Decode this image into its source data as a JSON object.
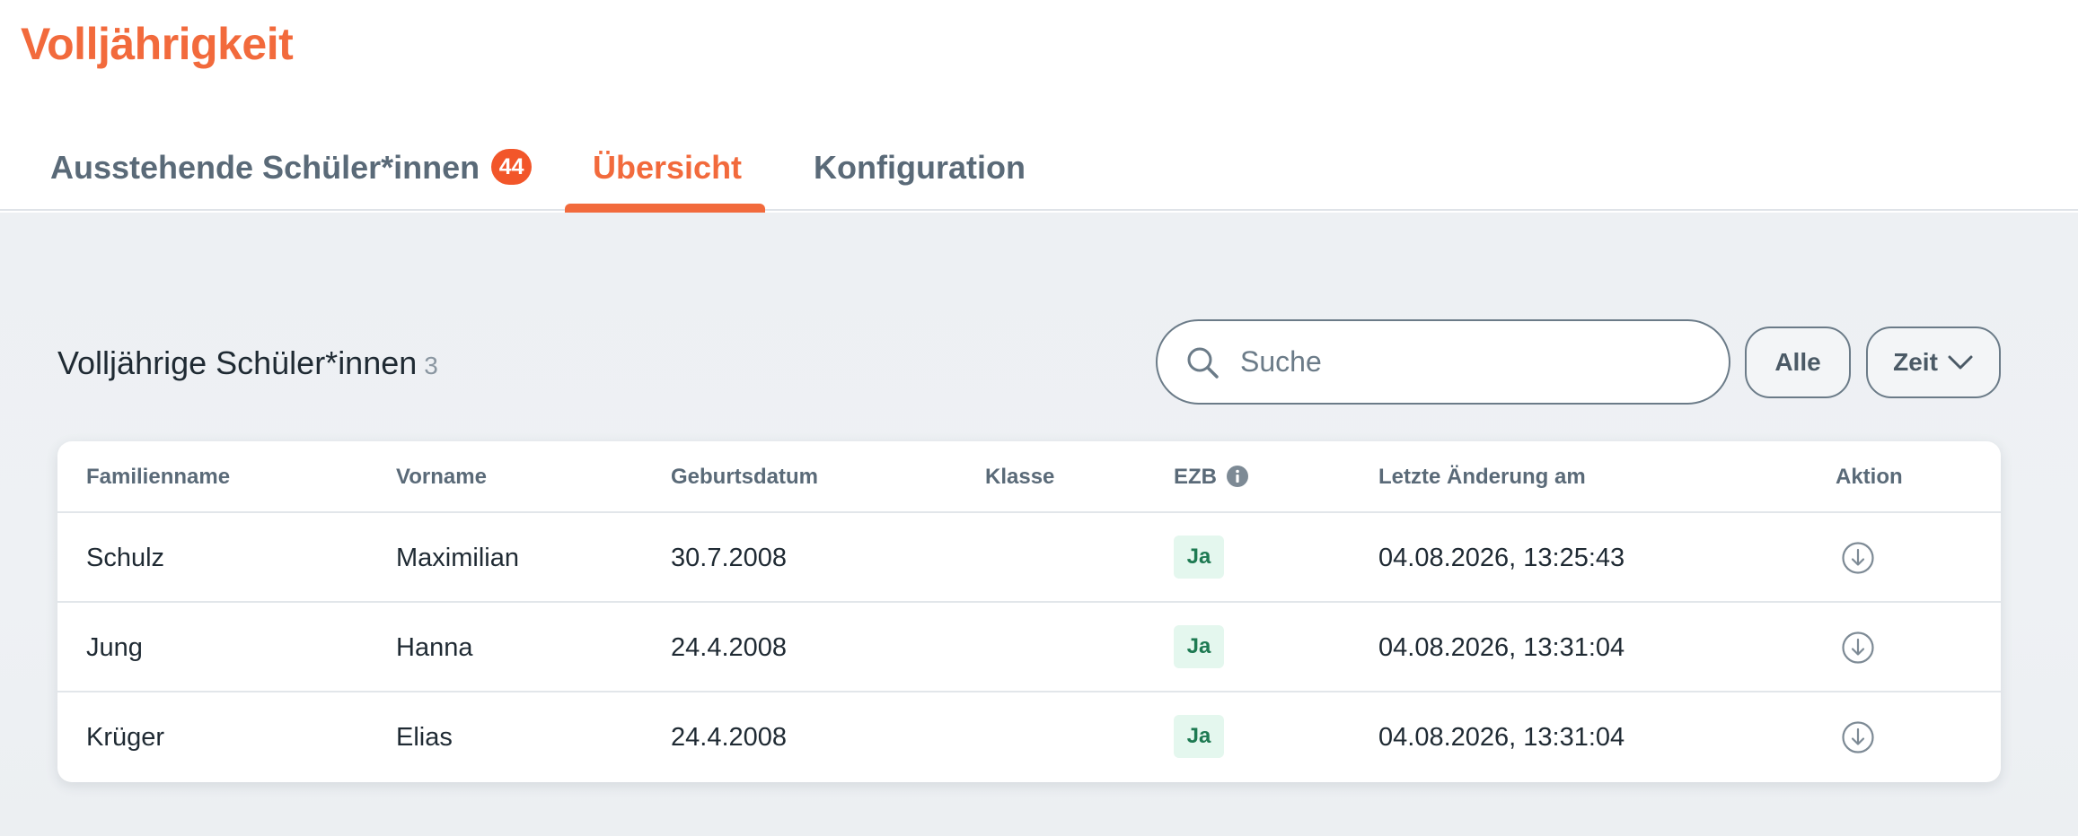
{
  "app": {
    "title": "Volljährigkeit"
  },
  "tabs": [
    {
      "label": "Ausstehende Schüler*innen",
      "badge": "44",
      "active": false
    },
    {
      "label": "Übersicht",
      "active": true
    },
    {
      "label": "Konfiguration",
      "active": false
    }
  ],
  "section": {
    "title": "Volljährige Schüler*innen",
    "count": "3"
  },
  "search": {
    "placeholder": "Suche",
    "value": "",
    "icon": "search-icon"
  },
  "filters": {
    "all_label": "Alle",
    "time_label": "Zeit",
    "time_icon": "chevron-down-icon"
  },
  "table": {
    "columns": [
      "Familienname",
      "Vorname",
      "Geburtsdatum",
      "Klasse",
      "EZB",
      "Letzte Änderung am",
      "Aktion"
    ],
    "ezb_info_icon": "info-icon",
    "action_icon": "download-icon",
    "rows": [
      {
        "familienname": "Schulz",
        "vorname": "Maximilian",
        "geburtsdatum": "30.7.2008",
        "klasse": "",
        "ezb": "Ja",
        "letzte_aenderung": "04.08.2026, 13:25:43"
      },
      {
        "familienname": "Jung",
        "vorname": "Hanna",
        "geburtsdatum": "24.4.2008",
        "klasse": "",
        "ezb": "Ja",
        "letzte_aenderung": "04.08.2026, 13:31:04"
      },
      {
        "familienname": "Krüger",
        "vorname": "Elias",
        "geburtsdatum": "24.4.2008",
        "klasse": "",
        "ezb": "Ja",
        "letzte_aenderung": "04.08.2026, 13:31:04"
      }
    ]
  },
  "colors": {
    "accent": "#f26a3c",
    "badge": "#f2562a",
    "ezb_bg": "#e4f7ee",
    "ezb_text": "#1e7a52",
    "text_muted": "#5a6a78"
  }
}
